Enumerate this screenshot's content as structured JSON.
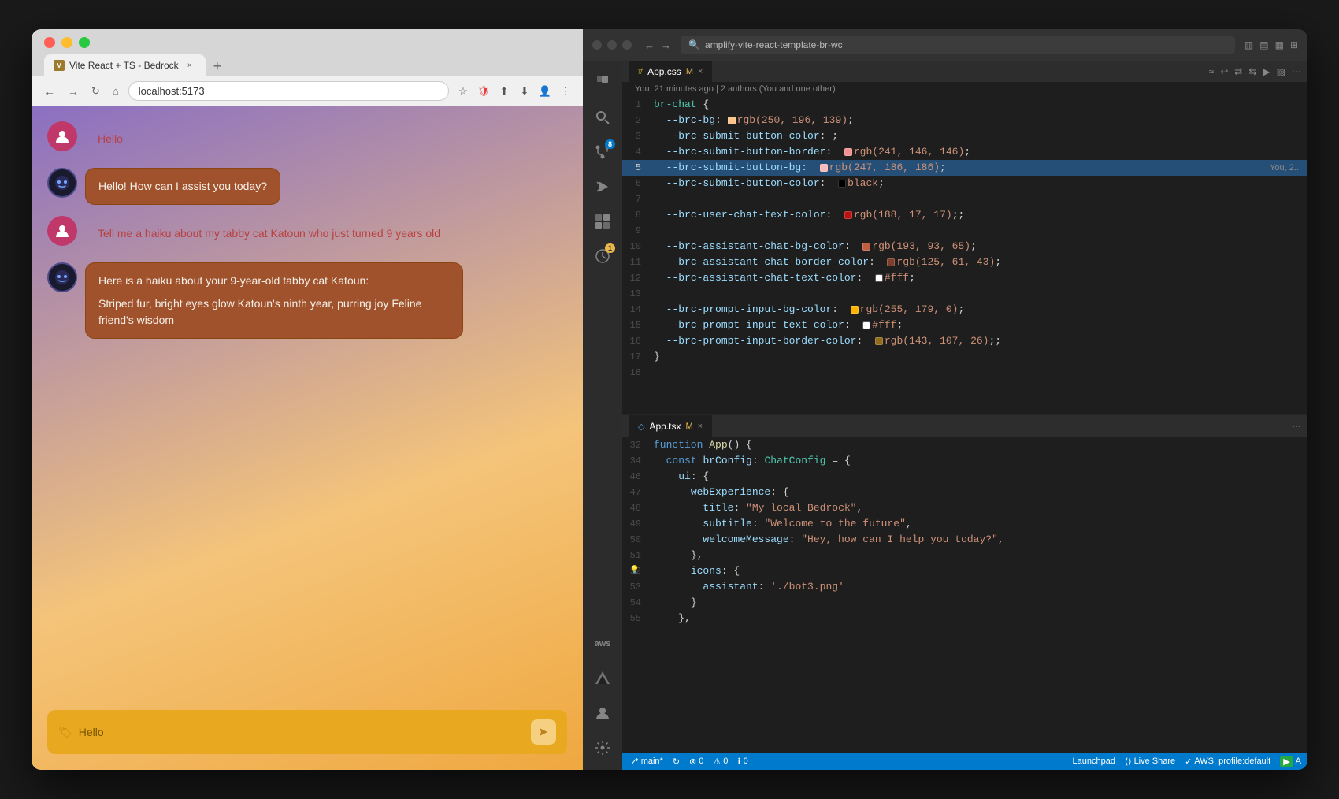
{
  "browser": {
    "tab_title": "Vite React + TS - Bedrock",
    "tab_close": "×",
    "tab_new": "+",
    "address": "localhost:5173",
    "favicon_text": "V"
  },
  "chat": {
    "messages": [
      {
        "type": "user",
        "text": "Hello"
      },
      {
        "type": "bot",
        "text": "Hello! How can I assist you today?"
      },
      {
        "type": "user",
        "text": "Tell me a haiku about my tabby cat Katoun who just turned 9 years old"
      },
      {
        "type": "bot",
        "text_line1": "Here is a haiku about your 9-year-old tabby cat Katoun:",
        "text_line2": "Striped fur, bright eyes glow Katoun's ninth year, purring joy Feline friend's wisdom"
      }
    ],
    "input_value": "Hello",
    "input_placeholder": "Hello"
  },
  "vscode": {
    "window_title": "amplify-vite-react-template-br-wc",
    "files": {
      "appcss_tab": "App.css",
      "appcss_badge": "M",
      "apptsx_tab": "App.tsx",
      "apptsx_badge": "M"
    },
    "git_info": "You, 21 minutes ago | 2 authors (You and one other)",
    "css_lines": [
      {
        "num": 1,
        "content": "br-chat {",
        "type": "selector"
      },
      {
        "num": 2,
        "content": "  --brc-bg: rgb(250, 196, 139);",
        "color": "#fac48b",
        "type": "var"
      },
      {
        "num": 3,
        "content": "  --brc-submit-button-color: ;",
        "type": "var"
      },
      {
        "num": 4,
        "content": "  --brc-submit-button-border:  rgb(241, 146, 146);",
        "color": "#f19292",
        "type": "var"
      },
      {
        "num": 5,
        "content": "  --brc-submit-button-bg:  rgb(247, 186, 186);",
        "color": "#f7baba",
        "type": "var",
        "highlighted": true
      },
      {
        "num": 6,
        "content": "  --brc-submit-button-color:  black;",
        "color": "#000000",
        "type": "var"
      },
      {
        "num": 7,
        "content": "",
        "type": "empty"
      },
      {
        "num": 8,
        "content": "  --brc-user-chat-text-color:  rgb(188, 17, 17);;",
        "color": "#bc1111",
        "type": "var"
      },
      {
        "num": 9,
        "content": "",
        "type": "empty"
      },
      {
        "num": 10,
        "content": "  --brc-assistant-chat-bg-color:  rgb(193, 93, 65);",
        "color": "#c15d41",
        "type": "var"
      },
      {
        "num": 11,
        "content": "  --brc-assistant-chat-border-color:  rgb(125, 61, 43);",
        "color": "#7d3d2b",
        "type": "var"
      },
      {
        "num": 12,
        "content": "  --brc-assistant-chat-text-color:  #fff;",
        "color": "#ffffff",
        "type": "var"
      },
      {
        "num": 13,
        "content": "",
        "type": "empty"
      },
      {
        "num": 14,
        "content": "  --brc-prompt-input-bg-color:  rgb(255, 179, 0);",
        "color": "#ffb300",
        "type": "var"
      },
      {
        "num": 15,
        "content": "  --brc-prompt-input-text-color:  #fff;",
        "color": "#ffffff",
        "type": "var"
      },
      {
        "num": 16,
        "content": "  --brc-prompt-input-border-color:  rgb(143, 107, 26);;",
        "color": "#8f6b1a",
        "type": "var"
      },
      {
        "num": 17,
        "content": "}",
        "type": "bracket"
      },
      {
        "num": 18,
        "content": "",
        "type": "empty"
      }
    ],
    "tsx_lines": [
      {
        "num": 32,
        "content": "function App() {",
        "type": "code"
      },
      {
        "num": 34,
        "content": "  const brConfig: ChatConfig = {",
        "type": "code"
      },
      {
        "num": 46,
        "content": "    ui: {",
        "type": "code"
      },
      {
        "num": 47,
        "content": "      webExperience: {",
        "type": "code"
      },
      {
        "num": 48,
        "content": "        title: \"My local Bedrock\",",
        "type": "code"
      },
      {
        "num": 49,
        "content": "        subtitle: \"Welcome to the future\",",
        "type": "code"
      },
      {
        "num": 50,
        "content": "        welcomeMessage: \"Hey, how can I help you today?\",",
        "type": "code"
      },
      {
        "num": 51,
        "content": "      },",
        "type": "code"
      },
      {
        "num": 52,
        "content": "      icons: {",
        "type": "code",
        "has_bulb": true
      },
      {
        "num": 53,
        "content": "        assistant: './bot3.png'",
        "type": "code"
      },
      {
        "num": 54,
        "content": "      }",
        "type": "code"
      },
      {
        "num": 55,
        "content": "    },",
        "type": "code"
      }
    ],
    "status": {
      "branch": "main*",
      "errors": "0",
      "warnings": "0",
      "info": "0",
      "live_share": "Live Share",
      "aws_profile": "AWS: profile:default",
      "launchpad": "Launchpad"
    }
  }
}
